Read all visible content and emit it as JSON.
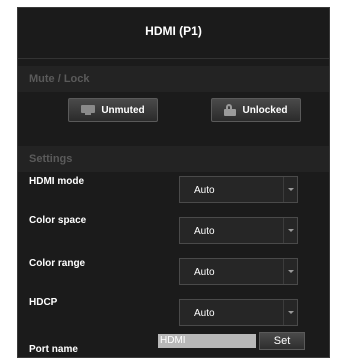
{
  "panel": {
    "title": "HDMI (P1)"
  },
  "mute_lock": {
    "section_label": "Mute / Lock",
    "mute_button": {
      "label": "Unmuted",
      "icon": "monitor-icon"
    },
    "lock_button": {
      "label": "Unlocked",
      "icon": "unlock-icon"
    }
  },
  "settings": {
    "section_label": "Settings",
    "rows": [
      {
        "label": "HDMI mode",
        "value": "Auto"
      },
      {
        "label": "Color space",
        "value": "Auto"
      },
      {
        "label": "Color range",
        "value": "Auto"
      },
      {
        "label": "HDCP",
        "value": "Auto"
      }
    ],
    "port_name": {
      "label": "Port name",
      "value": "HDMI",
      "set_label": "Set"
    }
  }
}
